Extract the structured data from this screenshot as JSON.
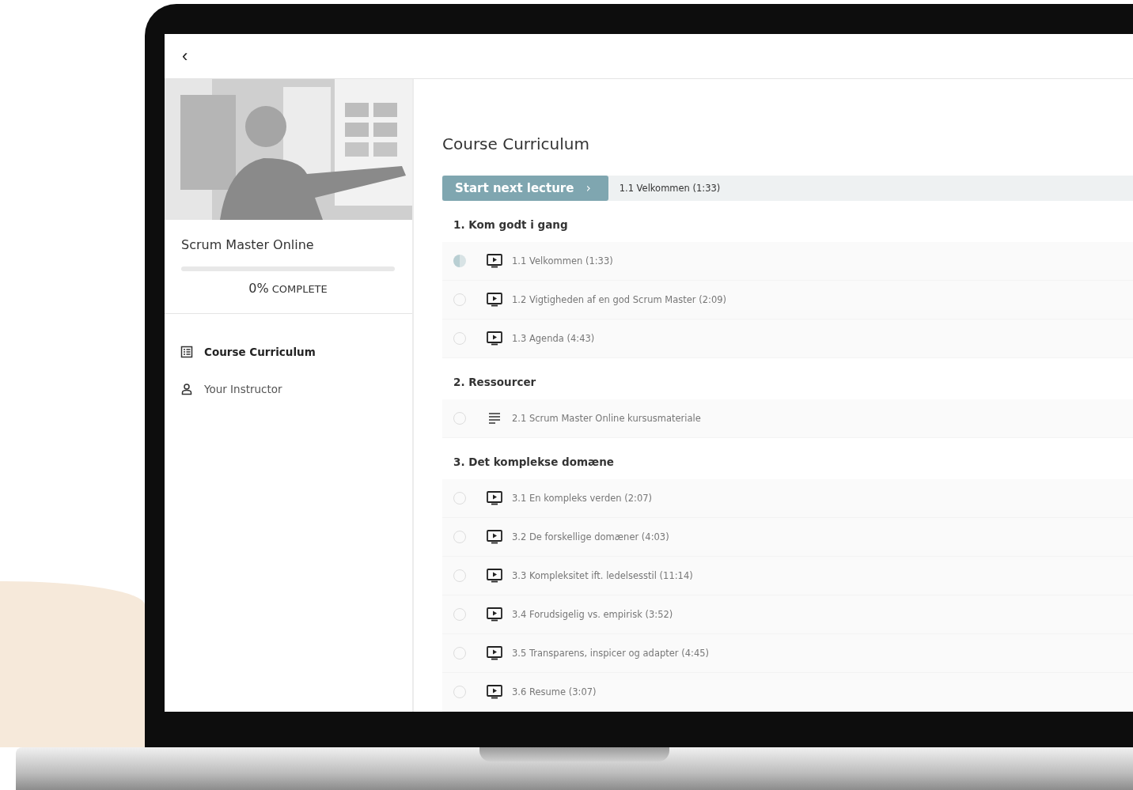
{
  "header": {
    "back": "‹"
  },
  "sidebar": {
    "course_title": "Scrum Master Online",
    "progress": {
      "level": 0,
      "percent": "0%",
      "label": "COMPLETE"
    },
    "items": [
      {
        "label": "Course Curriculum",
        "selected": true
      },
      {
        "label": "Your Instructor",
        "selected": false
      }
    ]
  },
  "main": {
    "title": "Course Curriculum",
    "next_button": "Start next lecture",
    "next_chevron": "›",
    "next_lecture": "1.1 Velkommen (1:33)",
    "sections": [
      {
        "title": "1. Kom godt i gang",
        "lectures": [
          {
            "kind": "video",
            "title": "1.1 Velkommen (1:33)",
            "started": true
          },
          {
            "kind": "video",
            "title": "1.2 Vigtigheden af en god Scrum Master (2:09)",
            "started": false
          },
          {
            "kind": "video",
            "title": "1.3 Agenda (4:43)",
            "started": false
          }
        ]
      },
      {
        "title": "2. Ressourcer",
        "lectures": [
          {
            "kind": "text",
            "title": "2.1 Scrum Master Online kursusmateriale",
            "started": false
          }
        ]
      },
      {
        "title": "3. Det komplekse domæne",
        "lectures": [
          {
            "kind": "video",
            "title": "3.1 En kompleks verden (2:07)",
            "started": false
          },
          {
            "kind": "video",
            "title": "3.2 De forskellige domæner (4:03)",
            "started": false
          },
          {
            "kind": "video",
            "title": "3.3 Kompleksitet ift. ledelsesstil (11:14)",
            "started": false
          },
          {
            "kind": "video",
            "title": "3.4 Forudsigelig vs. empirisk (3:52)",
            "started": false
          },
          {
            "kind": "video",
            "title": "3.5 Transparens, inspicer og adapter (4:45)",
            "started": false
          },
          {
            "kind": "video",
            "title": "3.6 Resume (3:07)",
            "started": false
          }
        ]
      }
    ]
  }
}
